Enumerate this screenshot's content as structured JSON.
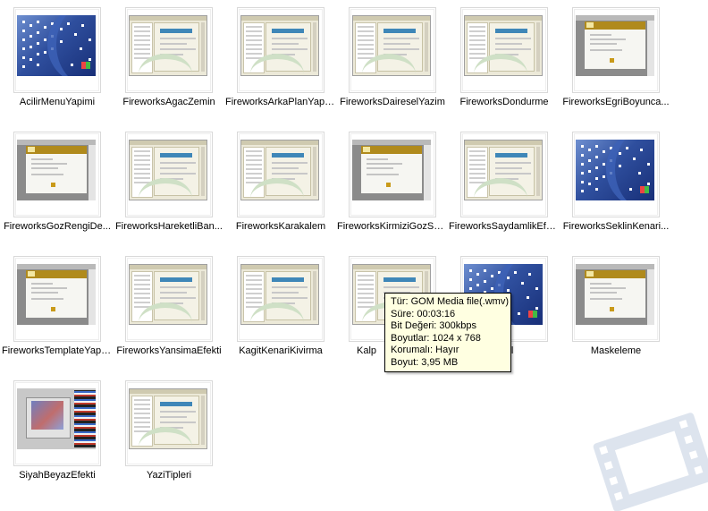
{
  "files": [
    {
      "name": "AcilirMenuYapimi",
      "thumb": "desktop"
    },
    {
      "name": "FireworksAgacZemin",
      "thumb": "app"
    },
    {
      "name": "FireworksArkaPlanYapimi",
      "thumb": "app"
    },
    {
      "name": "FireworksDaireselYazim",
      "thumb": "app"
    },
    {
      "name": "FireworksDondurme",
      "thumb": "app"
    },
    {
      "name": "FireworksEgriBoyunca...",
      "thumb": "dialog"
    },
    {
      "name": "FireworksGozRengiDe...",
      "thumb": "dialog"
    },
    {
      "name": "FireworksHareketliBan...",
      "thumb": "app"
    },
    {
      "name": "FireworksKarakalem",
      "thumb": "app"
    },
    {
      "name": "FireworksKirmiziGozSor...",
      "thumb": "dialog"
    },
    {
      "name": "FireworksSaydamlikEfekti",
      "thumb": "app"
    },
    {
      "name": "FireworksSeklinKenari...",
      "thumb": "desktop"
    },
    {
      "name": "FireworksTemplateYapimi",
      "thumb": "dialog"
    },
    {
      "name": "FireworksYansimaEfekti",
      "thumb": "app"
    },
    {
      "name": "KagitKenariKivirma",
      "thumb": "app"
    },
    {
      "name": "Kalp",
      "thumb": "app"
    },
    {
      "name": "dTool",
      "thumb": "desktop"
    },
    {
      "name": "Maskeleme",
      "thumb": "dialog"
    },
    {
      "name": "SiyahBeyazEfekti",
      "thumb": "photo"
    },
    {
      "name": "YaziTipleri",
      "thumb": "app"
    }
  ],
  "tooltip": {
    "type": "Tür: GOM Media file(.wmv)",
    "duration": "Süre: 00:03:16",
    "bitrate": "Bit Değeri: 300kbps",
    "dimensions": "Boyutlar: 1024 x 768",
    "protected": "Korumalı: Hayır",
    "size": "Boyut: 3,95 MB"
  },
  "watermark_icon": "film-strip-icon"
}
